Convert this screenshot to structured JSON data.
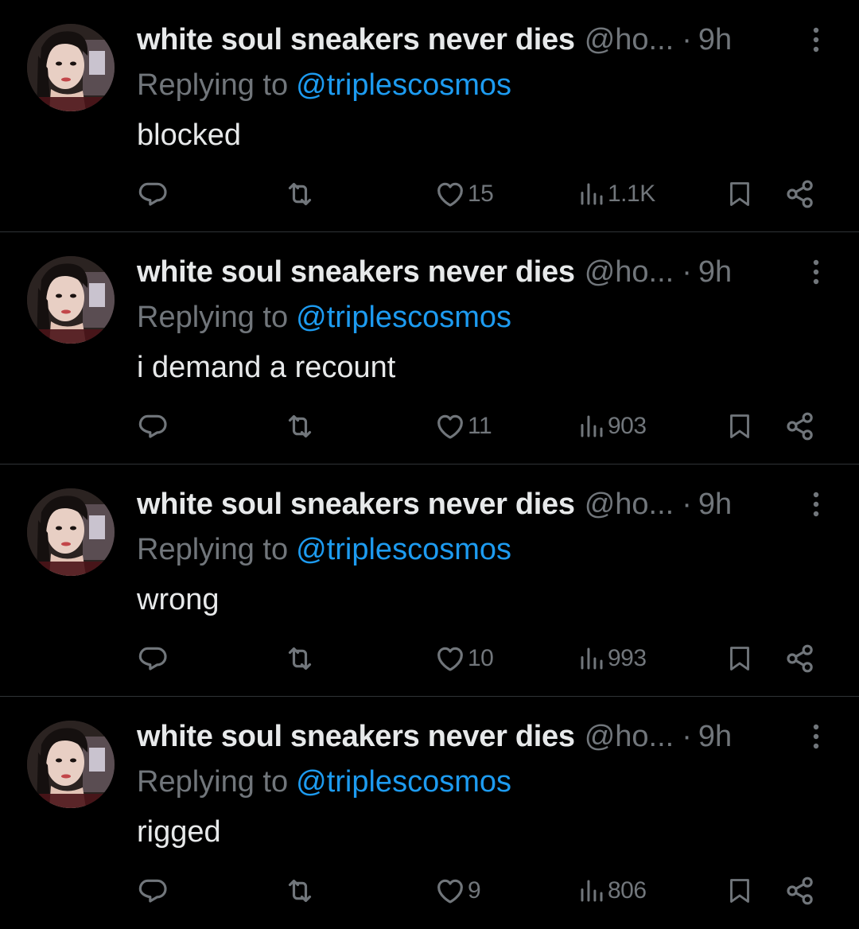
{
  "colors": {
    "background": "#000000",
    "primary_text": "#e7e9ea",
    "secondary_text": "#71767b",
    "link": "#1d9bf0",
    "divider": "#2f3336"
  },
  "icons": {
    "reply": "reply-icon",
    "retweet": "retweet-icon",
    "like": "heart-icon",
    "views": "views-bar-chart-icon",
    "bookmark": "bookmark-icon",
    "share": "share-icon",
    "more": "more-vertical-icon"
  },
  "tweets": [
    {
      "display_name": "white soul sneakers never dies",
      "handle": "@ho...",
      "separator": "·",
      "time": "9h",
      "replying_prefix": "Replying to",
      "replying_to": "@triplescosmos",
      "text": "blocked",
      "reply_count": "",
      "retweet_count": "",
      "like_count": "15",
      "view_count": "1.1K"
    },
    {
      "display_name": "white soul sneakers never dies",
      "handle": "@ho...",
      "separator": "·",
      "time": "9h",
      "replying_prefix": "Replying to",
      "replying_to": "@triplescosmos",
      "text": "i demand a recount",
      "reply_count": "",
      "retweet_count": "",
      "like_count": "11",
      "view_count": "903"
    },
    {
      "display_name": "white soul sneakers never dies",
      "handle": "@ho...",
      "separator": "·",
      "time": "9h",
      "replying_prefix": "Replying to",
      "replying_to": "@triplescosmos",
      "text": "wrong",
      "reply_count": "",
      "retweet_count": "",
      "like_count": "10",
      "view_count": "993"
    },
    {
      "display_name": "white soul sneakers never dies",
      "handle": "@ho...",
      "separator": "·",
      "time": "9h",
      "replying_prefix": "Replying to",
      "replying_to": "@triplescosmos",
      "text": "rigged",
      "reply_count": "",
      "retweet_count": "",
      "like_count": "9",
      "view_count": "806"
    }
  ]
}
